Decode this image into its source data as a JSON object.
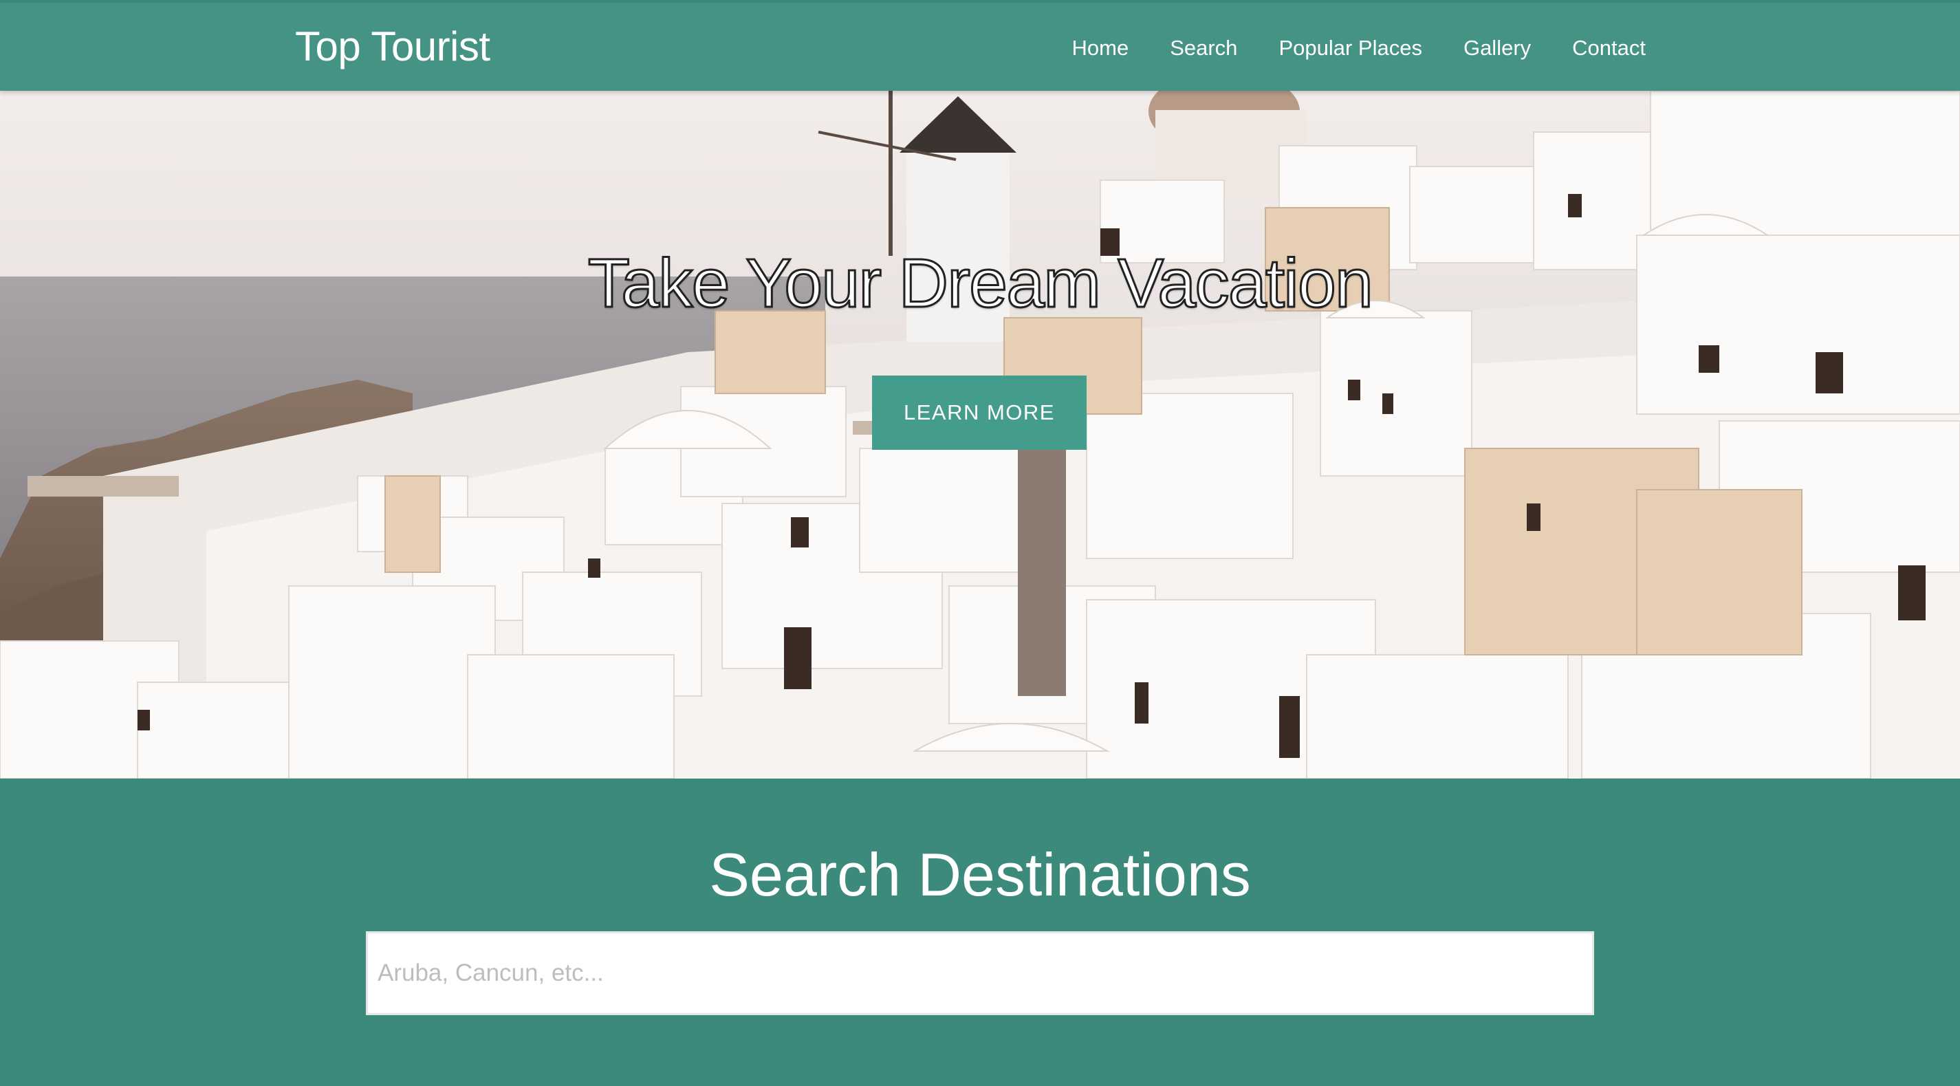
{
  "header": {
    "brand": "Top Tourist",
    "nav": [
      "Home",
      "Search",
      "Popular Places",
      "Gallery",
      "Contact"
    ]
  },
  "hero": {
    "title": "Take Your Dream Vacation",
    "button_label": "LEARN MORE",
    "image": "santorini-whitewashed-village-photo"
  },
  "search": {
    "title": "Search Destinations",
    "placeholder": "Aruba, Cancun, etc..."
  },
  "colors": {
    "header": "#449384",
    "button": "#449c8c",
    "section": "#3b8a7b"
  }
}
